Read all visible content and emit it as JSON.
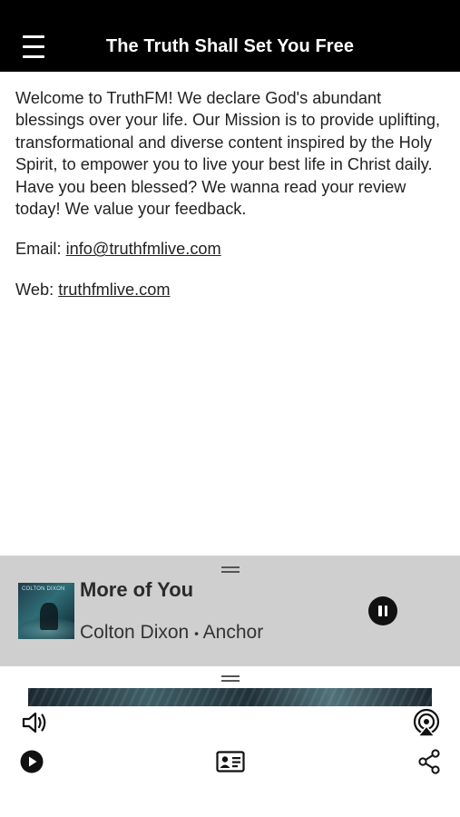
{
  "header": {
    "title": "The Truth Shall Set You Free",
    "menu_icon": "hamburger-menu-icon"
  },
  "content": {
    "intro": "Welcome to TruthFM! We declare God's abundant blessings over your life. Our Mission is to provide uplifting, transformational and diverse content inspired by the Holy Spirit, to empower you to live your best life in Christ daily. Have you been blessed? We wanna read your review today! We value your feedback.",
    "email_label": "Email: ",
    "email_value": "info@truthfmlive.com",
    "web_label": "Web: ",
    "web_value": "truthfmlive.com"
  },
  "player": {
    "song_title": "More of You",
    "artist": "Colton Dixon",
    "separator": "•",
    "album": "Anchor",
    "album_art_text": "COLTON DIXON",
    "pause_icon": "pause-icon"
  },
  "controls": {
    "volume_icon": "speaker-volume-icon",
    "airplay_icon": "airplay-icon",
    "play_icon": "play-icon",
    "contact_icon": "contact-card-icon",
    "share_icon": "share-icon"
  },
  "colors": {
    "header_bg": "#000000",
    "player_bg": "#cfcfcf",
    "text": "#222222"
  }
}
